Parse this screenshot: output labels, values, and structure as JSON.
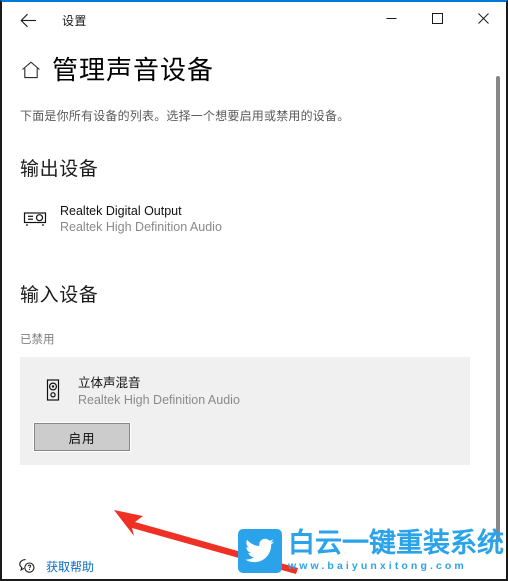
{
  "window": {
    "app_title": "设置",
    "back_icon": "back-arrow-icon",
    "minimize_label": "最小化",
    "maximize_label": "最大化",
    "close_label": "关闭",
    "accent_color": "#0078d7",
    "border_color": "#1a1a1a"
  },
  "page": {
    "home_icon": "home-icon",
    "title": "管理声音设备",
    "description": "下面是你所有设备的列表。选择一个想要启用或禁用的设备。"
  },
  "output_section": {
    "title": "输出设备",
    "devices": [
      {
        "icon": "audio-output-device-icon",
        "name": "Realtek Digital Output",
        "driver": "Realtek High Definition Audio"
      }
    ]
  },
  "input_section": {
    "title": "输入设备",
    "status_label": "已禁用",
    "selected_device": {
      "icon": "audio-input-device-icon",
      "name": "立体声混音",
      "driver": "Realtek High Definition Audio",
      "card_background": "#f0f0f0"
    },
    "enable_button_label": "启用"
  },
  "footer": {
    "help_icon": "help-question-bubble-icon",
    "help_label": "获取帮助",
    "help_link_color": "#0a6cc4"
  },
  "annotation": {
    "arrow_color": "#ee3124",
    "points_at": "启用"
  },
  "watermark": {
    "logo_icon": "bird-logo-icon",
    "brand": "白云一键重装系统",
    "url": "www.baiyunxitong.com",
    "color": "#2aa3ea"
  },
  "scrollbar": {
    "orientation": "vertical"
  }
}
